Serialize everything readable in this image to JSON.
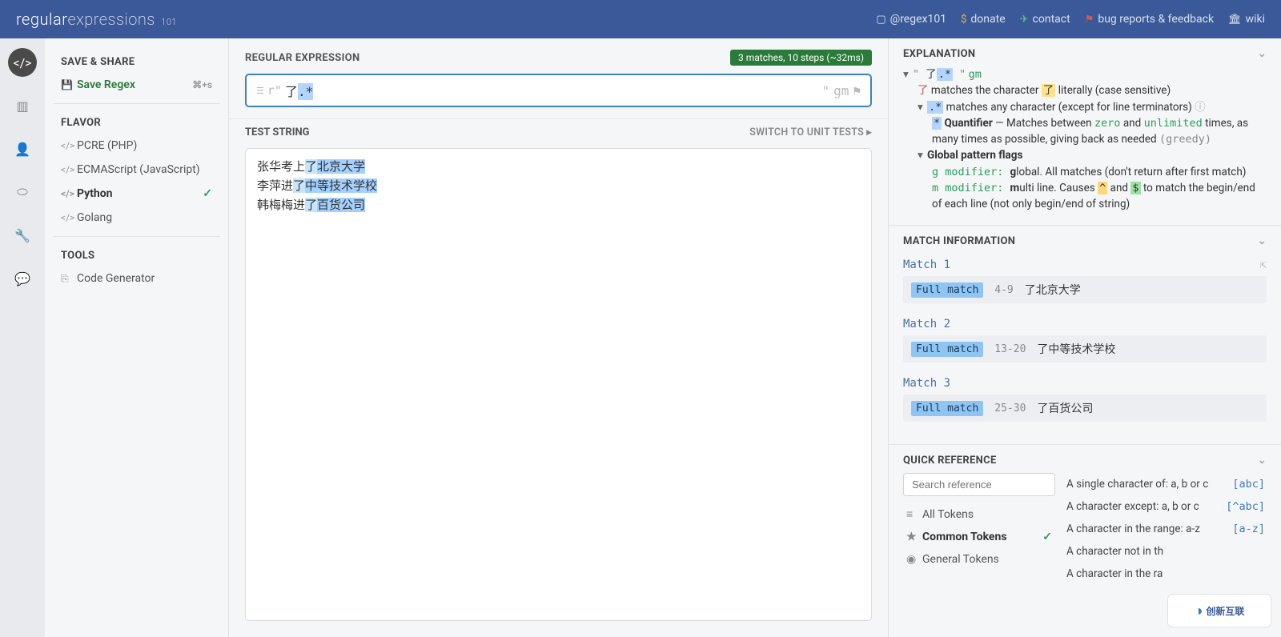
{
  "header": {
    "logo_main": "regular",
    "logo_thin": "expressions",
    "logo_sub": "101",
    "links": {
      "twitter": "@regex101",
      "donate": "donate",
      "contact": "contact",
      "bugs": "bug reports & feedback",
      "wiki": "wiki"
    }
  },
  "leftnav": {
    "items": [
      "code",
      "book",
      "user",
      "mask",
      "wrench",
      "chat"
    ]
  },
  "sidebar": {
    "save_title": "SAVE & SHARE",
    "save_label": "Save Regex",
    "save_shortcut": "⌘+s",
    "flavor_title": "FLAVOR",
    "flavors": [
      {
        "label": "PCRE (PHP)",
        "selected": false
      },
      {
        "label": "ECMAScript (JavaScript)",
        "selected": false
      },
      {
        "label": "Python",
        "selected": true
      },
      {
        "label": "Golang",
        "selected": false
      }
    ],
    "tools_title": "TOOLS",
    "tools": [
      {
        "label": "Code Generator"
      }
    ]
  },
  "regex": {
    "title": "REGULAR EXPRESSION",
    "match_badge": "3 matches, 10 steps (~32ms)",
    "delim_left": "r\"",
    "pattern_plain": "了",
    "pattern_hl": ".*",
    "delim_right": "\"",
    "flags": "gm"
  },
  "test": {
    "title": "TEST STRING",
    "switch": "SWITCH TO UNIT TESTS ▸",
    "lines": [
      {
        "pre": "张华考上",
        "m1": "了",
        "m2": "北京大学"
      },
      {
        "pre": "李萍进",
        "m1": "了",
        "m2": "中等技术学校"
      },
      {
        "pre": "韩梅梅进",
        "m1": "了",
        "m2": "百货公司"
      }
    ]
  },
  "explanation": {
    "title": "EXPLANATION",
    "root_quote_l": "\" ",
    "root_plain": "了",
    "root_hl": ".*",
    "root_quote_r": " \"",
    "root_flags": "gm",
    "line1_char": "了",
    "line1_text": " matches the character ",
    "line1_tail": " literally (case sensitive)",
    "line2_hl": ".*",
    "line2_text": " matches any character (except for line terminators) ",
    "line3_star": "*",
    "line3_bold": " Quantifier",
    "line3_text": " — Matches between ",
    "line3_zero": "zero",
    "line3_and": " and ",
    "line3_unl": "unlimited",
    "line3_tail": " times, as many times as possible, giving back as needed ",
    "line3_greedy": "(greedy)",
    "flags_title": "Global pattern flags",
    "flag_g_code": "g modifier: ",
    "flag_g_bold": "g",
    "flag_g_text": "lobal. All matches (don't return after first match)",
    "flag_m_code": "m modifier: ",
    "flag_m_bold": "m",
    "flag_m_text1": "ulti line. Causes ",
    "flag_m_caret": "^",
    "flag_m_and": " and ",
    "flag_m_dollar": "$",
    "flag_m_text2": " to match the begin/end of each line (not only begin/end of string)"
  },
  "match_info": {
    "title": "MATCH INFORMATION",
    "matches": [
      {
        "title": "Match 1",
        "label": "Full match",
        "range": "4-9",
        "text": "了北京大学"
      },
      {
        "title": "Match 2",
        "label": "Full match",
        "range": "13-20",
        "text": "了中等技术学校"
      },
      {
        "title": "Match 3",
        "label": "Full match",
        "range": "25-30",
        "text": "了百货公司"
      }
    ]
  },
  "quickref": {
    "title": "QUICK REFERENCE",
    "search_placeholder": "Search reference",
    "categories": [
      {
        "icon": "≡",
        "label": "All Tokens",
        "selected": false
      },
      {
        "icon": "★",
        "label": "Common Tokens",
        "selected": true
      },
      {
        "icon": "◉",
        "label": "General Tokens",
        "selected": false
      }
    ],
    "items": [
      {
        "desc": "A single character of: a, b or c",
        "sym": "[abc]"
      },
      {
        "desc": "A character except: a, b or c",
        "sym": "[^abc]"
      },
      {
        "desc": "A character in the range: a-z",
        "sym": "[a-z]"
      },
      {
        "desc": "A character not in th",
        "sym": ""
      },
      {
        "desc": "A character in the ra",
        "sym": ""
      }
    ]
  },
  "watermark": "创新互联"
}
